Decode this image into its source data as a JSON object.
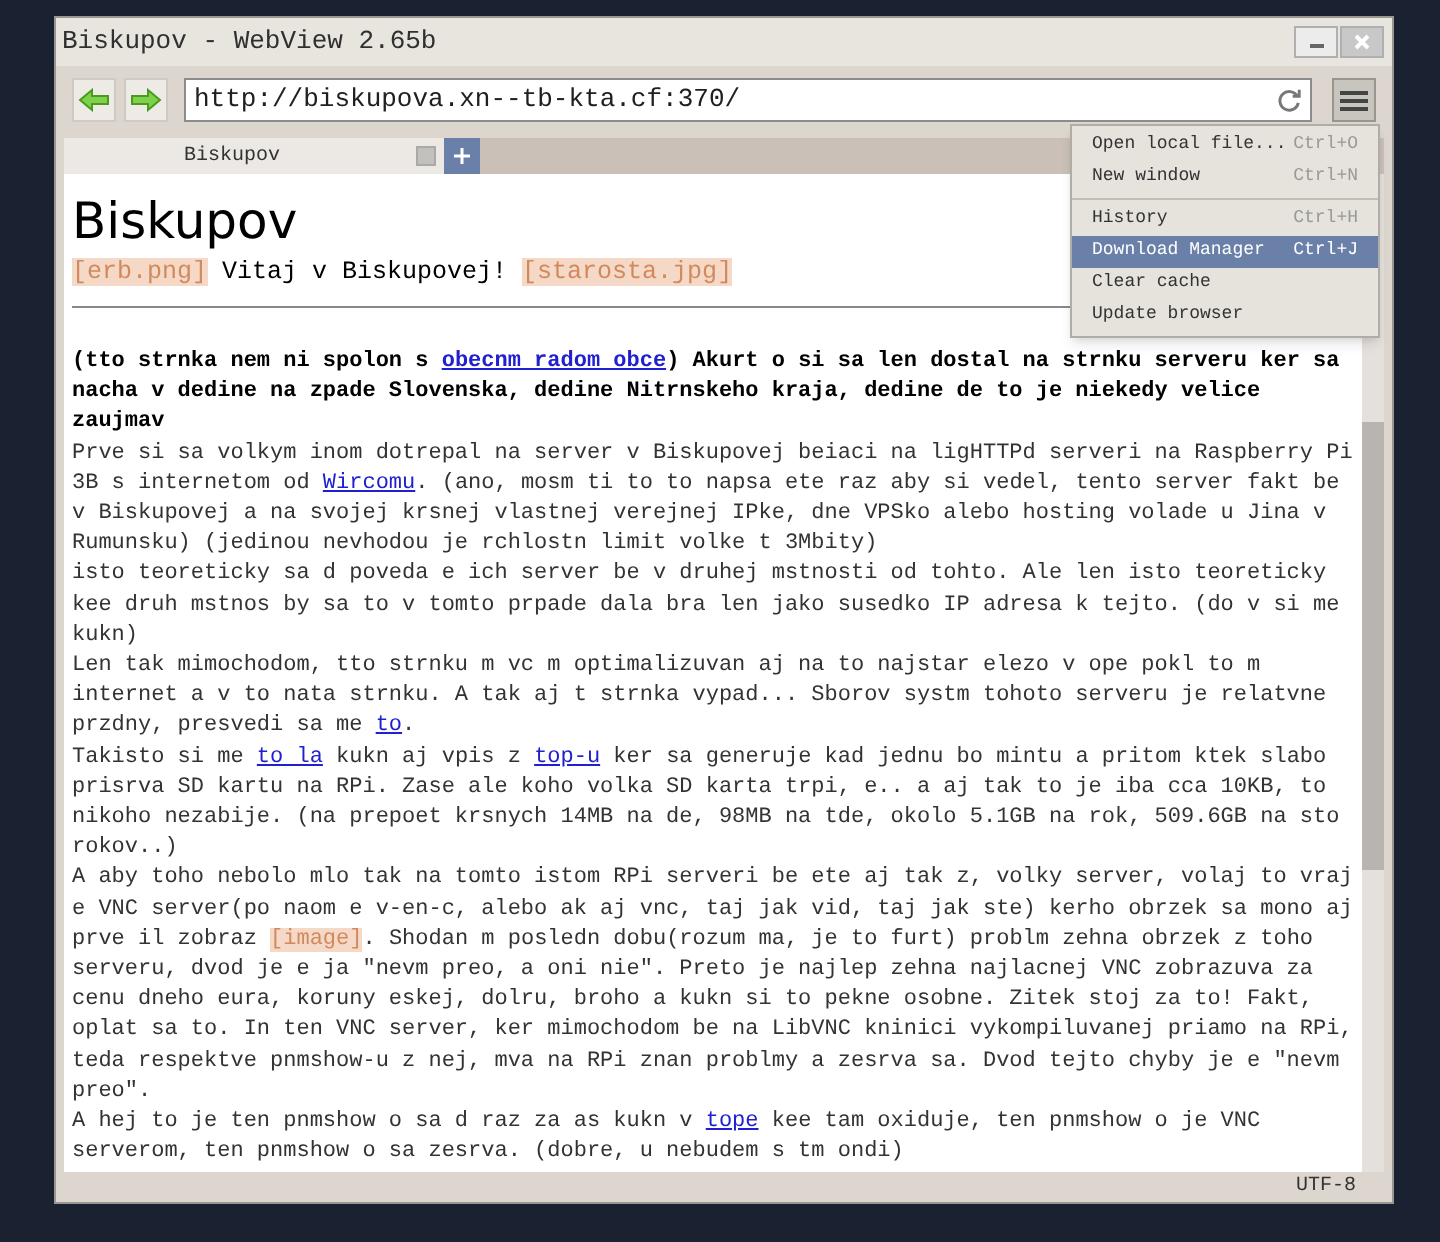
{
  "window": {
    "title": "Biskupov - WebView 2.65b"
  },
  "address_bar": {
    "value": "http://biskupova.xn--tb-kta.cf:370/"
  },
  "tabs": [
    {
      "label": "Biskupov",
      "selected": true
    }
  ],
  "menu": {
    "items": [
      {
        "label": "Open local file...",
        "shortcut": "Ctrl+O",
        "selected": false,
        "divider_above": false
      },
      {
        "label": "New window",
        "shortcut": "Ctrl+N",
        "selected": false,
        "divider_above": false
      },
      {
        "label": "History",
        "shortcut": "Ctrl+H",
        "selected": false,
        "divider_above": true
      },
      {
        "label": "Download Manager",
        "shortcut": "Ctrl+J",
        "selected": true,
        "divider_above": false
      },
      {
        "label": "Clear cache",
        "selected": false,
        "divider_above": false
      },
      {
        "label": "Update browser",
        "selected": false,
        "divider_above": false
      }
    ]
  },
  "page": {
    "heading": "Biskupov",
    "subtitle": [
      {
        "kind": "image",
        "text": "[erb.png]"
      },
      {
        "kind": "text",
        "text": " Vitaj v Biskupovej! "
      },
      {
        "kind": "image",
        "text": "[starosta.jpg]"
      }
    ],
    "paragraphs": [
      {
        "bold": true,
        "segments": [
          {
            "kind": "text",
            "text": "(tto strnka nem ni spolon s "
          },
          {
            "kind": "link",
            "text": "obecnm radom obce"
          },
          {
            "kind": "text",
            "text": ") Akurt o si sa len dostal na strnku serveru ker sa nacha v dedine na zpade Slovenska, dedine Nitrnskeho kraja, dedine de to je niekedy velice zaujmav"
          }
        ]
      },
      {
        "bold": false,
        "segments": [
          {
            "kind": "text",
            "text": "Prve si sa volkym inom dotrepal na server v Biskupovej beiaci na ligHTTPd serveri na Raspberry Pi 3B s internetom od "
          },
          {
            "kind": "link",
            "text": "Wircomu"
          },
          {
            "kind": "text",
            "text": ". (ano, mosm ti to to napsa ete raz aby si vedel, tento server fakt be v Biskupovej a na svojej krsnej vlastnej verejnej IPke, dne VPSko alebo hosting volade u Jina v Rumunsku) (jedinou nevhodou je rchlostn limit volke t 3Mbity)"
          }
        ]
      },
      {
        "bold": false,
        "segments": [
          {
            "kind": "text",
            "text": "isto teoreticky sa d poveda e ich server be v druhej mstnosti od tohto. Ale len isto teoreticky kee druh mstnos by sa to v tomto prpade dala bra len jako susedko IP adresa k tejto. (do v si me kukn)"
          }
        ]
      },
      {
        "bold": false,
        "segments": [
          {
            "kind": "text",
            "text": "Len tak mimochodom, tto strnku m vc m optimalizuvan aj na to najstar elezo v ope pokl to m internet a v to nata strnku. A tak aj t strnka vypad... Sborov systm tohoto serveru je relatvne przdny, presvedi sa me "
          },
          {
            "kind": "link",
            "text": "to"
          },
          {
            "kind": "text",
            "text": "."
          }
        ]
      },
      {
        "bold": false,
        "segments": [
          {
            "kind": "text",
            "text": "Takisto si me "
          },
          {
            "kind": "link",
            "text": "to la"
          },
          {
            "kind": "text",
            "text": " kukn aj vpis z "
          },
          {
            "kind": "link",
            "text": "top-u"
          },
          {
            "kind": "text",
            "text": " ker sa generuje kad jednu bo mintu a pritom ktek slabo prisrva SD kartu na RPi. Zase ale koho volka SD karta trpi, e.. a aj tak to je iba cca 10KB, to nikoho nezabije. (na prepoet krsnych 14MB na de, 98MB na tde, okolo 5.1GB na rok, 509.6GB na sto rokov..)"
          }
        ]
      },
      {
        "bold": false,
        "segments": [
          {
            "kind": "text",
            "text": "A aby toho nebolo mlo tak na tomto istom RPi serveri be ete aj tak z, volky server, volaj to vraj e VNC server(po naom e v-en-c, alebo ak aj vnc, taj jak vid, taj jak ste) kerho obrzek sa mono aj prve il zobraz "
          },
          {
            "kind": "image",
            "text": "[image]"
          },
          {
            "kind": "text",
            "text": ". Shodan m posledn dobu(rozum ma, je to furt) problm zehna obrzek z toho serveru, dvod je e ja \"nevm preo, a oni nie\". Preto je najlep zehna najlacnej VNC zobrazuva za cenu dneho eura, koruny eskej, dolru, broho a kukn si to pekne osobne. Zitek stoj za to! Fakt, oplat sa to. In ten VNC server, ker mimochodom be na LibVNC kninici vykompiluvanej priamo na RPi, teda respektve pnmshow-u z nej, mva na RPi znan problmy a zesrva sa. Dvod tejto chyby je e \"nevm preo\"."
          }
        ]
      },
      {
        "bold": false,
        "segments": [
          {
            "kind": "text",
            "text": "A hej to je ten pnmshow o sa d raz za as kukn v "
          },
          {
            "kind": "link",
            "text": "tope"
          },
          {
            "kind": "text",
            "text": " kee tam oxiduje, ten pnmshow o je VNC serverom, ten pnmshow o sa zesrva. (dobre, u nebudem s tm ondi)"
          }
        ]
      }
    ]
  },
  "status_bar": {
    "encoding": "UTF-8"
  }
}
